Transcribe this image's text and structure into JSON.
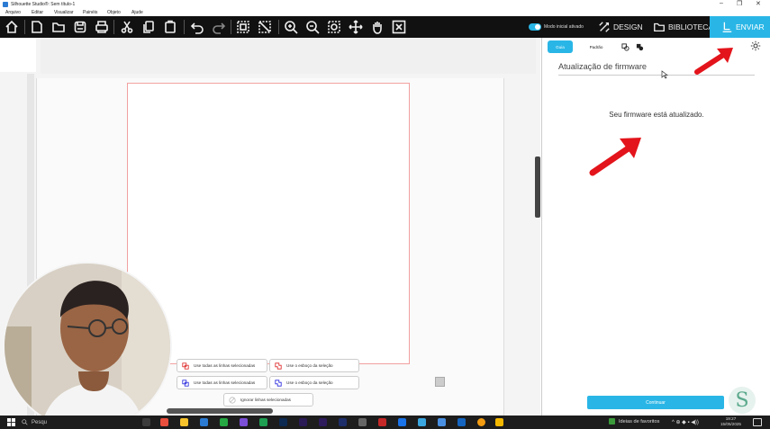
{
  "window": {
    "title": "Silhouette Studio®: Sem título-1",
    "minimize": "–",
    "maximize": "❐",
    "close": "✕"
  },
  "menu": [
    "Arquivo",
    "Editar",
    "Visualizar",
    "Painéis",
    "Objeto",
    "Ajude"
  ],
  "toolbar": {
    "toggle_label": "Modo inicial ativado",
    "tabs": {
      "design": "DESIGN",
      "library": "BIBLIOTECA",
      "send": "ENVIAR"
    }
  },
  "panel": {
    "tabs": [
      "Guia",
      "Padrão"
    ],
    "firmware_title": "Atualização de firmware",
    "firmware_status": "Seu firmware está atualizado.",
    "continue_label": "Continuar",
    "logo_letter": "S"
  },
  "canvas": {
    "line_options": {
      "use_all_selected_1": "Use todas as linhas selecionadas",
      "use_selection_outline_1": "Use o esboço da seleção",
      "use_all_selected_2": "Use todas as linhas selecionadas",
      "use_selection_outline_2": "Use o esboço da seleção",
      "ignore_selected": "Ignorar linhas selecionadas"
    }
  },
  "taskbar": {
    "search_placeholder": "Pesqu",
    "favorites": "Ideias de favoritos",
    "clock_time": "19:27",
    "clock_date": "15/05/2025"
  },
  "colors": {
    "accent": "#29b6e6",
    "toolbar_bg": "#111111",
    "annotation_arrow": "#e3141b"
  }
}
